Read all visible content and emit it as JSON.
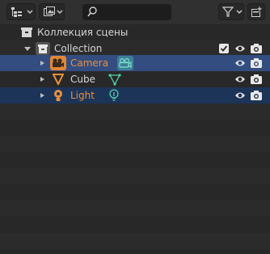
{
  "header": {
    "display_mode_icon": "outliner-view-icon",
    "view_icon": "image-view-icon",
    "search": {
      "value": "",
      "placeholder": ""
    },
    "filter_icon": "funnel-icon",
    "new_collection_icon": "new-collection-icon"
  },
  "tree": {
    "scene_collection": {
      "label": "Коллекция сцены"
    },
    "collection": {
      "label": "Collection",
      "checked": true
    },
    "items": [
      {
        "label": "Camera",
        "type": "camera",
        "data_icon": "camera-data-icon",
        "label_color": "#e8913a",
        "selected": true
      },
      {
        "label": "Cube",
        "type": "mesh",
        "data_icon": "mesh-data-icon",
        "label_color": "#d6d6d6",
        "selected": false
      },
      {
        "label": "Light",
        "type": "light",
        "data_icon": "light-data-icon",
        "label_color": "#e8913a",
        "selected": false
      }
    ]
  },
  "colors": {
    "selected_row": "#334d80",
    "highlight_row": "#1d3459",
    "object_orange": "#e8913a",
    "data_green": "#4fd1a8",
    "background": "#282828"
  }
}
